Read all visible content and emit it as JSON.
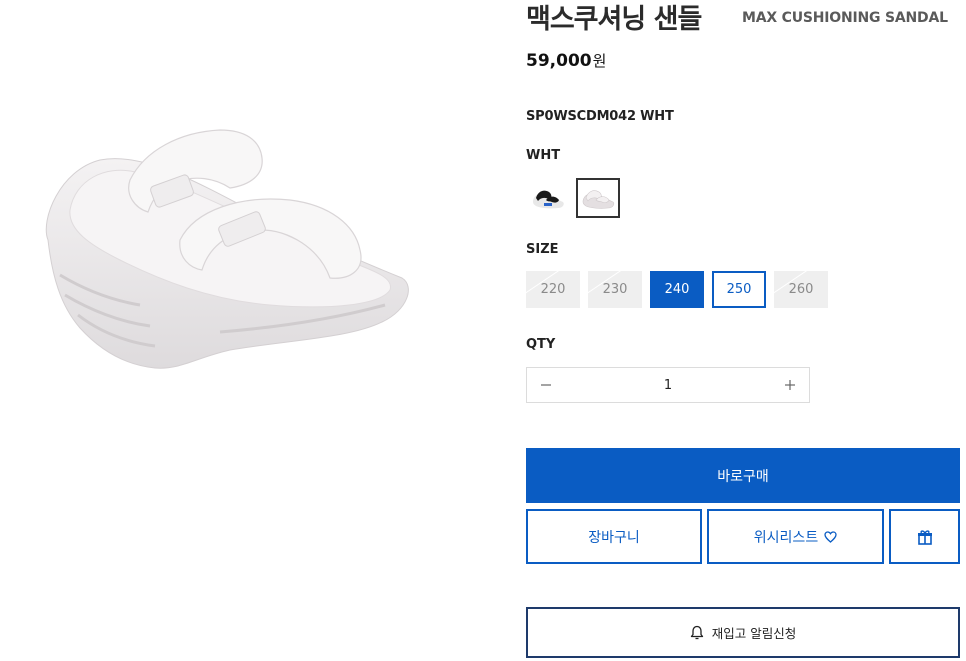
{
  "product": {
    "title_ko": "맥스쿠셔닝 샌들",
    "title_en": "MAX CUSHIONING SANDAL",
    "price": "59,000",
    "currency": "원",
    "sku": "SP0WSCDM042 WHT"
  },
  "color": {
    "label": "WHT",
    "swatches": [
      {
        "name": "BLK"
      },
      {
        "name": "WHT"
      }
    ]
  },
  "size": {
    "label": "SIZE",
    "options": [
      {
        "value": "220",
        "state": "soldout"
      },
      {
        "value": "230",
        "state": "soldout"
      },
      {
        "value": "240",
        "state": "selected"
      },
      {
        "value": "250",
        "state": "available"
      },
      {
        "value": "260",
        "state": "soldout"
      }
    ]
  },
  "qty": {
    "label": "QTY",
    "value": "1"
  },
  "actions": {
    "buy_now": "바로구매",
    "cart": "장바구니",
    "wishlist": "위시리스트",
    "restock_alert": "재입고 알림신청"
  },
  "icons": {
    "minus": "minus-icon",
    "plus": "plus-icon",
    "heart": "heart-icon",
    "gift": "gift-icon",
    "bell": "bell-icon"
  },
  "colors": {
    "accent": "#0a5cc3",
    "restock_border": "#1e3a6b",
    "soldout_bg": "#efefef"
  }
}
